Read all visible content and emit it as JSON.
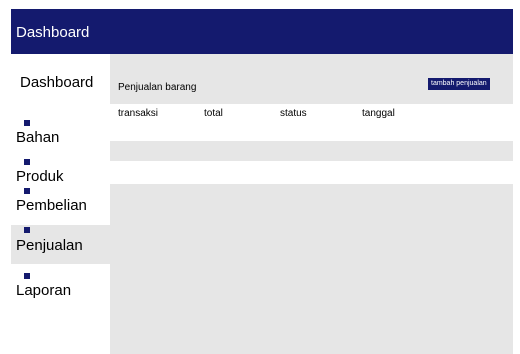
{
  "header": {
    "title": "Dashboard"
  },
  "sidebar": {
    "heading": "Dashboard",
    "items": [
      {
        "label": "Bahan",
        "active": false
      },
      {
        "label": "Produk",
        "active": false
      },
      {
        "label": "Pembelian",
        "active": false
      },
      {
        "label": "Penjualan",
        "active": true
      },
      {
        "label": "Laporan",
        "active": false
      }
    ]
  },
  "main": {
    "title": "Penjualan barang",
    "add_button": "tambah penjualan",
    "table": {
      "columns": [
        "transaksi",
        "total",
        "status",
        "tanggal"
      ],
      "rows": []
    }
  },
  "colors": {
    "accent": "#141a6e",
    "background": "#e6e6e6",
    "panel": "#ffffff"
  }
}
